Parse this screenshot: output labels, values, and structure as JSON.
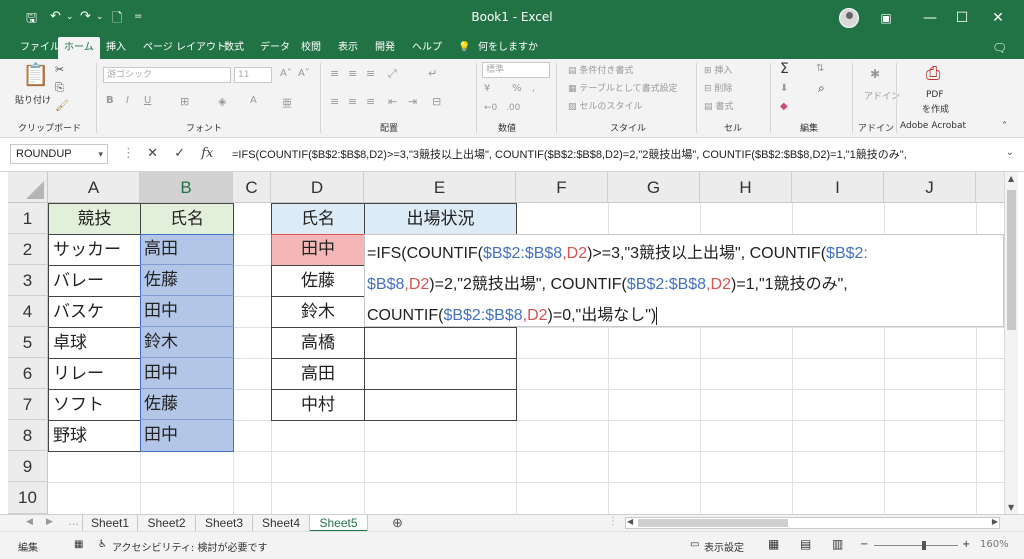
{
  "titlebar": {
    "title": "Book1 - Excel",
    "save_icon": "save-icon",
    "undo_icon": "undo-icon",
    "redo_icon": "redo-icon",
    "minimize": "—",
    "restore": "☐",
    "close": "✕"
  },
  "menu": {
    "tabs": [
      "ファイル",
      "ホーム",
      "挿入",
      "ページ レイアウト",
      "数式",
      "データ",
      "校閲",
      "表示",
      "開発",
      "ヘルプ",
      "何をしますか"
    ],
    "active": "ホーム"
  },
  "ribbon": {
    "groups": [
      "クリップボード",
      "フォント",
      "配置",
      "数値",
      "スタイル",
      "セル",
      "編集",
      "アドイン",
      "Adobe Acrobat"
    ],
    "paste_label": "貼り付け",
    "font_name": "游ゴシック",
    "font_size": "11",
    "number_format": "標準",
    "cond_format": "条件付き書式",
    "table_format": "テーブルとして書式設定",
    "cell_style": "セルのスタイル",
    "insert": "挿入",
    "delete": "削除",
    "format": "書式",
    "addin": "アドイン",
    "pdf": "PDF",
    "pdf_create": "を作成"
  },
  "formula_bar": {
    "name_box": "ROUNDUP",
    "cancel": "✕",
    "enter": "✓",
    "fx": "fx",
    "formula": "=IFS(COUNTIF($B$2:$B$8,D2)>=3,\"3競技以上出場\", COUNTIF($B$2:$B$8,D2)=2,\"2競技出場\", COUNTIF($B$2:$B$8,D2)=1,\"1競技のみ\","
  },
  "grid": {
    "columns": [
      "A",
      "B",
      "C",
      "D",
      "E",
      "F",
      "G",
      "H",
      "I",
      "J"
    ],
    "rows": [
      "1",
      "2",
      "3",
      "4",
      "5",
      "6",
      "7",
      "8",
      "9",
      "10"
    ],
    "colA_header": "競技",
    "colB_header": "氏名",
    "colA": [
      "サッカー",
      "バレー",
      "バスケ",
      "卓球",
      "リレー",
      "ソフト",
      "野球"
    ],
    "colB": [
      "高田",
      "佐藤",
      "田中",
      "鈴木",
      "田中",
      "佐藤",
      "田中"
    ],
    "colD_header": "氏名",
    "colE_header": "出場状況",
    "colD": [
      "田中",
      "佐藤",
      "鈴木",
      "高橋",
      "高田",
      "中村"
    ],
    "edit": {
      "l1_a": "=IFS(COUNTIF(",
      "l1_b": "$B$2:$B$8",
      "l1_c": ",",
      "l1_d": "D2",
      "l1_e": ")>=3,\"3競技以上出場\", COUNTIF(",
      "l1_f": "$B$2:",
      "l2_a": "$B$8",
      "l2_b": ",",
      "l2_c": "D2",
      "l2_d": ")=2,\"2競技出場\", COUNTIF(",
      "l2_e": "$B$2:$B$8",
      "l2_f": ",",
      "l2_g": "D2",
      "l2_h": ")=1,\"1競技のみ\",",
      "l3_a": "COUNTIF(",
      "l3_b": "$B$2:$B$8",
      "l3_c": ",",
      "l3_d": "D2",
      "l3_e": ")=0,\"出場なし\")"
    }
  },
  "sheets": {
    "tabs": [
      "Sheet1",
      "Sheet2",
      "Sheet3",
      "Sheet4",
      "Sheet5"
    ],
    "active": "Sheet5",
    "add": "⊕"
  },
  "status": {
    "mode": "編集",
    "accessibility": "アクセシビリティ: 検討が必要です",
    "display_settings": "表示設定",
    "zoom": "160%"
  },
  "colors": {
    "excel_green": "#217346",
    "header_green": "#e2efda",
    "header_blue": "#ddebf7",
    "selection_blue": "#b4c6e7",
    "ref_red_fill": "#f4b6b6"
  }
}
